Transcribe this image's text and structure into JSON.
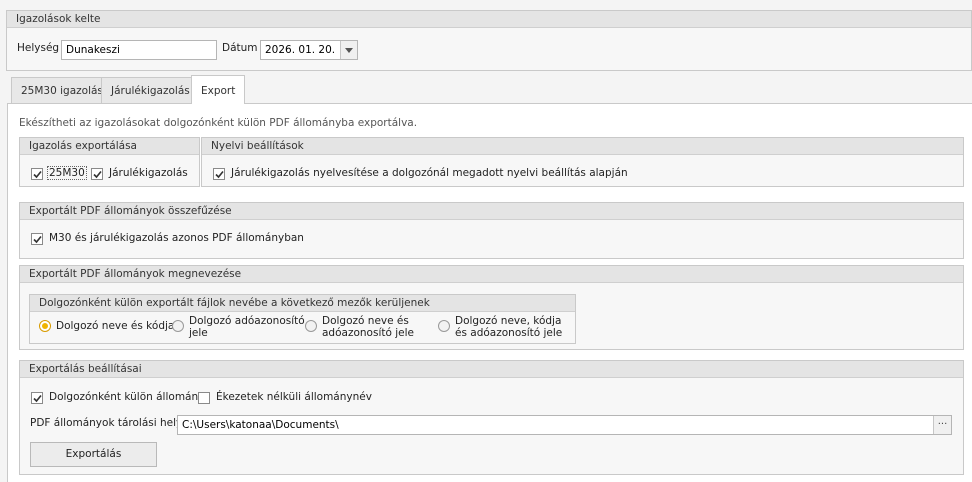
{
  "header_group": {
    "title": "Igazolások kelte",
    "city_label": "Helység",
    "city_value": "Dunakeszi",
    "date_label": "Dátum",
    "date_value": "2026. 01. 20."
  },
  "tabs": [
    {
      "label": "25M30 igazolás",
      "active": false
    },
    {
      "label": "Járulékigazolás",
      "active": false
    },
    {
      "label": "Export",
      "active": true
    }
  ],
  "export": {
    "description": "Ekészítheti az igazolásokat dolgozónként külön PDF állományba exportálva.",
    "export_group": {
      "title": "Igazolás exportálása",
      "cb_25m30": {
        "label": "25M30",
        "checked": true
      },
      "cb_jarulek": {
        "label": "Járulékigazolás",
        "checked": true
      }
    },
    "lang_group": {
      "title": "Nyelvi beállítások",
      "cb_lang": {
        "label": "Járulékigazolás nyelvesítése a dolgozónál megadott nyelvi beállítás alapján",
        "checked": true
      }
    },
    "merge_group": {
      "title": "Exportált PDF állományok összefűzése",
      "cb_merge": {
        "label": "M30 és járulékigazolás azonos PDF állományban",
        "checked": true
      }
    },
    "naming_group": {
      "title": "Exportált PDF állományok megnevezése",
      "inner_title": "Dolgozónként külön exportált fájlok nevébe a következő mezők kerüljenek",
      "options": [
        {
          "line1": "Dolgozó neve és kódja",
          "line2": "",
          "selected": true
        },
        {
          "line1": "Dolgozó adóazonosító",
          "line2": "jele",
          "selected": false
        },
        {
          "line1": "Dolgozó neve és",
          "line2": "adóazonosító jele",
          "selected": false
        },
        {
          "line1": "Dolgozó neve, kódja",
          "line2": "és adóazonosító jele",
          "selected": false
        }
      ]
    },
    "settings_group": {
      "title": "Exportálás beállításai",
      "cb_separate": {
        "label": "Dolgozónként külön állomány",
        "checked": true
      },
      "cb_noaccent": {
        "label": "Ékezetek nélküli állománynév",
        "checked": false
      },
      "path_label": "PDF állományok tárolási helye",
      "path_value": "C:\\Users\\katonaa\\Documents\\",
      "browse_label": "···",
      "export_button": "Exportálás"
    }
  }
}
